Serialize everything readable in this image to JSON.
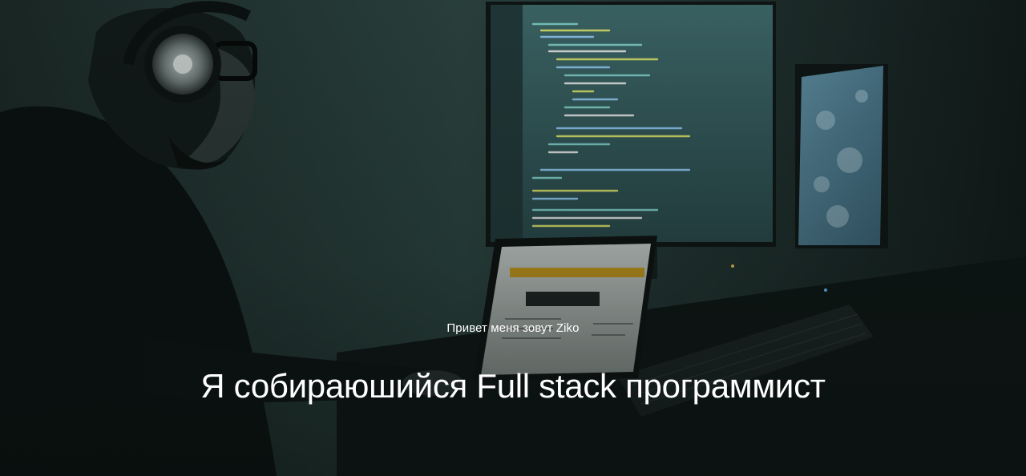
{
  "hero": {
    "greeting": "Привет меня зовут Ziko",
    "title": "Я собираюшийся Full stack программист",
    "background_image": "programmer-at-desk-with-monitors-photo",
    "colors": {
      "text": "#ffffff",
      "background_tint": "#1a2a28"
    }
  }
}
